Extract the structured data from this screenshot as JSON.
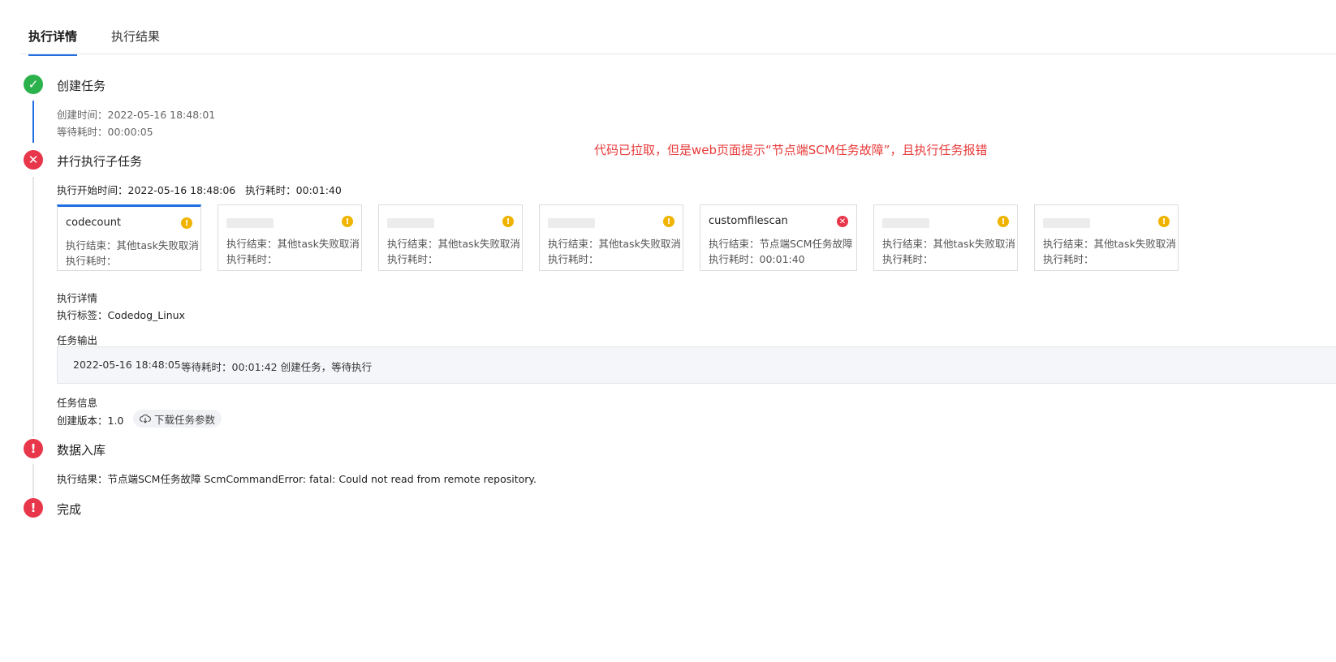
{
  "tabs": [
    {
      "label": "执行详情",
      "active": true
    },
    {
      "label": "执行结果",
      "active": false
    }
  ],
  "annotation": "代码已拉取，但是web页面提示“节点端SCM任务故障”，且执行任务报错",
  "steps": {
    "create": {
      "title": "创建任务",
      "created_time": "创建时间：2022-05-16 18:48:01",
      "wait_time": "等待耗时：00:00:05"
    },
    "parallel": {
      "title": "并行执行子任务",
      "summary": "执行开始时间：2022-05-16 18:48:06   执行耗时：00:01:40",
      "cards": [
        {
          "name": "codecount",
          "status": "warning",
          "result": "执行结束：其他task失败取消",
          "duration": "执行耗时："
        },
        {
          "name": "",
          "status": "warning",
          "result": "执行结束：其他task失败取消",
          "duration": "执行耗时："
        },
        {
          "name": "",
          "status": "warning",
          "result": "执行结束：其他task失败取消",
          "duration": "执行耗时："
        },
        {
          "name": "",
          "status": "warning",
          "result": "执行结束：其他task失败取消",
          "duration": "执行耗时："
        },
        {
          "name": "customfilescan",
          "status": "error",
          "result": "执行结束：节点端SCM任务故障",
          "duration": "执行耗时：00:01:40"
        },
        {
          "name": "",
          "status": "warning",
          "result": "执行结束：其他task失败取消",
          "duration": "执行耗时："
        },
        {
          "name": "",
          "status": "warning",
          "result": "执行结束：其他task失败取消",
          "duration": "执行耗时："
        }
      ],
      "detail_heading": "执行详情",
      "exec_tag": "执行标签：Codedog_Linux",
      "output_heading": "任务输出",
      "output_time": "2022-05-16 18:48:05",
      "output_text": "等待耗时：00:01:42 创建任务，等待执行",
      "info_heading": "任务信息",
      "version": "创建版本：1.0",
      "download_label": "下载任务参数"
    },
    "ingest": {
      "title": "数据入库",
      "result": "执行结果：节点端SCM任务故障 ScmCommandError: fatal: Could not read from remote repository."
    },
    "done": {
      "title": "完成"
    }
  },
  "colors": {
    "accent": "#1f6fe0",
    "success": "#2bb24c",
    "error": "#e8364a",
    "warning": "#f0b400",
    "annotation": "#e83a3a"
  }
}
